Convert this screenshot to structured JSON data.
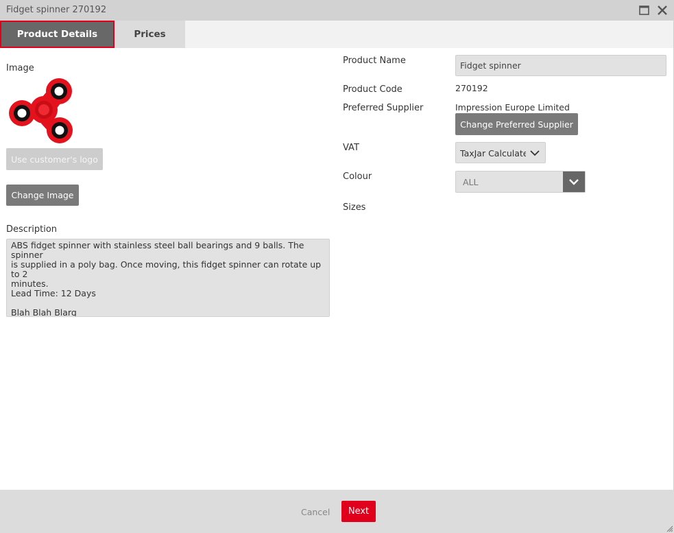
{
  "window": {
    "title": "Fidget spinner 270192",
    "maximize_icon": "maximize-icon",
    "close_icon": "close-icon"
  },
  "tabs": [
    {
      "label": "Product Details",
      "active": true
    },
    {
      "label": "Prices",
      "active": false
    }
  ],
  "left": {
    "image_label": "Image",
    "use_logo_label": "Use customer's logo",
    "change_image_label": "Change Image",
    "description_label": "Description",
    "description_value": "ABS fidget spinner with stainless steel ball bearings and 9 balls. The spinner\nis supplied in a poly bag. Once moving, this fidget spinner can rotate up to 2\nminutes.\nLead Time: 12 Days\n\nBlah Blah Blarg"
  },
  "right": {
    "product_name_label": "Product Name",
    "product_name_value": "Fidget spinner",
    "product_code_label": "Product Code",
    "product_code_value": "270192",
    "preferred_supplier_label": "Preferred Supplier",
    "preferred_supplier_value": "Impression Europe Limited",
    "change_supplier_label": "Change Preferred Supplier",
    "vat_label": "VAT",
    "vat_value": "TaxJar Calculated",
    "colour_label": "Colour",
    "colour_value": "ALL",
    "sizes_label": "Sizes"
  },
  "footer": {
    "cancel_label": "Cancel",
    "next_label": "Next"
  },
  "colors": {
    "accent": "#e0001b",
    "active_tab": "#686868",
    "button_grey": "#7a7a7a",
    "spinner_red": "#e3121c"
  }
}
